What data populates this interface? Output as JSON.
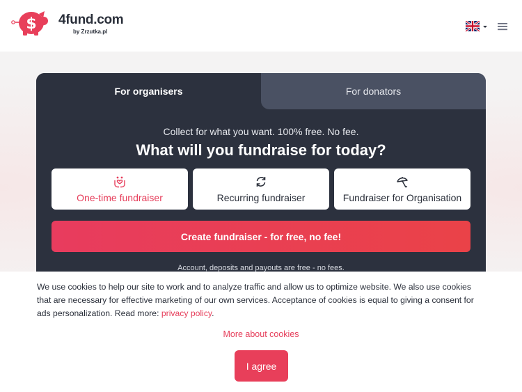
{
  "header": {
    "logo_name": "4fund.com",
    "logo_sub": "by Zrzutka.pl",
    "language_icon": "uk-flag-icon",
    "menu_icon": "hamburger-menu-icon"
  },
  "tabs": [
    {
      "label": "For organisers",
      "active": true
    },
    {
      "label": "For donators",
      "active": false
    }
  ],
  "hero": {
    "subtitle": "Collect for what you want. 100% free. No fee.",
    "title": "What will you fundraise for today?"
  },
  "options": [
    {
      "label": "One-time fundraiser",
      "icon": "hands-heart-icon",
      "selected": true
    },
    {
      "label": "Recurring fundraiser",
      "icon": "refresh-icon",
      "selected": false
    },
    {
      "label": "Fundraiser for Organisation",
      "icon": "umbrella-icon",
      "selected": false
    }
  ],
  "cta": {
    "label": "Create fundraiser - for free, no fee!"
  },
  "note": "Account, deposits and payouts are free - no fees.",
  "cookie": {
    "text": "We use cookies to help our site to work and to analyze traffic and allow us to optimize website. We also use cookies that are necessary for effective marketing of our own services. Acceptance of cookies is equal to giving a consent for ads personalization. Read more: ",
    "link": "privacy policy",
    "after_link": ".",
    "more": "More about cookies",
    "agree": "I agree"
  },
  "colors": {
    "accent": "#e83f5a",
    "card": "#2c313e",
    "tab_inactive": "#4a5163"
  }
}
